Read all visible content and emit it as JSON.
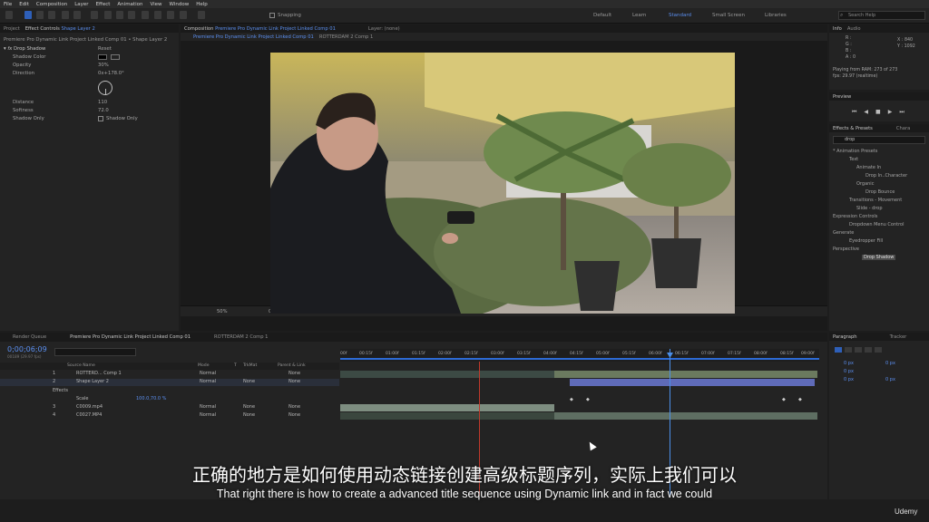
{
  "menu": [
    "File",
    "Edit",
    "Composition",
    "Layer",
    "Effect",
    "Animation",
    "View",
    "Window",
    "Help"
  ],
  "toolbar": {
    "snapping_label": "Snapping",
    "workspaces": [
      "Default",
      "Learn",
      "Standard",
      "Small Screen",
      "Libraries"
    ],
    "active_workspace": "Standard",
    "search_placeholder": "Search Help"
  },
  "left_panel": {
    "tab_project": "Project",
    "tab_effect_controls": "Effect Controls",
    "effect_controls_layer": "Shape Layer 2",
    "header": "Premiere Pro Dynamic Link Project Linked Comp 01 • Shape Layer 2",
    "effect_name": "Drop Shadow",
    "reset_label": "Reset",
    "props": {
      "shadow_color": "Shadow Color",
      "opacity": "Opacity",
      "opacity_value": "30%",
      "direction": "Direction",
      "direction_value": "0x+178.0°",
      "distance": "Distance",
      "distance_value": "110",
      "softness": "Softness",
      "softness_value": "72.0",
      "shadow_only": "Shadow Only",
      "shadow_only_checkbox": "Shadow Only"
    }
  },
  "comp_panel": {
    "tab_composition": "Composition",
    "comp_name": "Premiere Pro Dynamic Link Project Linked Comp 01",
    "tab_layer": "Layer: (none)",
    "subtab_active": "Premiere Pro Dynamic Link Project Linked Comp 01",
    "subtab_other": "ROTTERDAM 2 Comp 1",
    "footer": {
      "zoom": "50%",
      "timecode": "0;00;02;17",
      "resolution": "Quarter",
      "camera": "Active Camera",
      "views": "1 View",
      "exposure": "+0.0"
    }
  },
  "info_panel": {
    "tab_info": "Info",
    "tab_audio": "Audio",
    "r": "R :",
    "g": "G :",
    "b": "B :",
    "a": "A : 0",
    "x": "X : 840",
    "y": "Y : 1092",
    "playing": "Playing from RAM: 273 of 273",
    "fps": "fps: 29.97 (realtime)"
  },
  "preview_panel": {
    "title": "Preview"
  },
  "effects_presets": {
    "tab": "Effects & Presets",
    "tab_other": "Chara",
    "search_value": "drop",
    "tree": [
      "* Animation Presets",
      "Text",
      "Animate In",
      "Drop In..Character",
      "Organic",
      "Drop Bounce",
      "Transitions - Movement",
      "Slide - drop",
      "Expression Controls",
      "Dropdown Menu Control",
      "Generate",
      "Eyedropper Fill",
      "Perspective",
      "Drop Shadow"
    ]
  },
  "paragraph_panel": {
    "tab": "Paragraph",
    "tab_other": "Tracker",
    "values": [
      "0 px",
      "0 px",
      "0 px",
      "0 px",
      "0 px"
    ]
  },
  "timeline": {
    "tab_render_queue": "Render Queue",
    "tab_active": "Premiere Pro Dynamic Link Project Linked Comp 01",
    "tab_other": "ROTTERDAM 2 Comp 1",
    "timecode": "0;00;06;09",
    "frame_info": "00189 (29.97 fps)",
    "columns": {
      "source_name": "Source Name",
      "mode": "Mode",
      "t": "T",
      "trkmat": "TrkMat",
      "parent": "Parent & Link"
    },
    "layers": [
      {
        "num": "1",
        "name": "ROTTERD... Comp 1",
        "mode": "Normal",
        "trkmat": "",
        "parent": "None"
      },
      {
        "num": "2",
        "name": "Shape Layer 2",
        "mode": "Normal",
        "trkmat": "None",
        "parent": "None"
      },
      {
        "num": "3",
        "name": "C0009.mp4",
        "mode": "Normal",
        "trkmat": "None",
        "parent": "None"
      },
      {
        "num": "4",
        "name": "C0027.MP4",
        "mode": "Normal",
        "trkmat": "None",
        "parent": "None"
      }
    ],
    "effects_label": "Effects",
    "scale_label": "Scale",
    "scale_value": "100.0,70.0 %",
    "ruler": [
      "00f",
      "00:15f",
      "01:00f",
      "01:15f",
      "02:00f",
      "02:15f",
      "03:00f",
      "03:15f",
      "04:00f",
      "04:15f",
      "05:00f",
      "05:15f",
      "06:00f",
      "06:15f",
      "07:00f",
      "07:15f",
      "08:00f",
      "08:15f",
      "09:00f"
    ]
  },
  "subtitles": {
    "chinese": "正确的地方是如何使用动态链接创建高级标题序列，实际上我们可以",
    "english": "That right there is how to create a advanced title sequence using Dynamic link and in fact we could"
  },
  "watermark": "Udemy",
  "colors": {
    "accent_blue": "#5b8ff0",
    "playhead": "#4b8fe8",
    "panel": "#232323",
    "dark": "#1a1a1a"
  }
}
